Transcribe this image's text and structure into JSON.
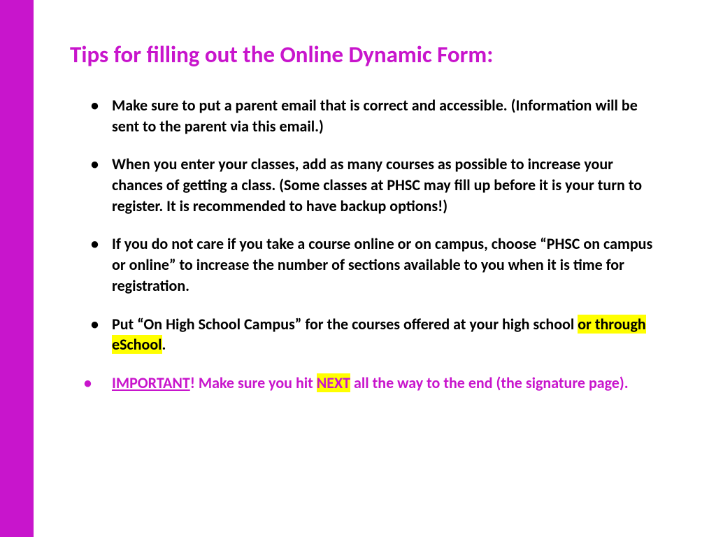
{
  "title": "Tips for filling out the Online Dynamic Form:",
  "bullets": [
    {
      "text": "Make sure to put a parent email that is correct and accessible. (Information will be sent to the parent via this email.)"
    },
    {
      "text": "When you enter your classes, add as many courses as possible to increase your chances of getting a class. (Some classes at PHSC may fill up before it is your turn to register. It is recommended to have backup options!)"
    },
    {
      "text": "If you do not care if you take a course online or on campus, choose “PHSC on campus or online” to increase the number of sections available to you when it is time for registration."
    },
    {
      "pre": "Put “On High School Campus” for the courses offered at your high school ",
      "hl": "or through eSchool",
      "post": "."
    },
    {
      "important_ul": "IMPORTANT",
      "after_ul": "! Make sure you hit ",
      "hl": "NEXT",
      "post": " all the way to the end (the signature page)."
    }
  ]
}
